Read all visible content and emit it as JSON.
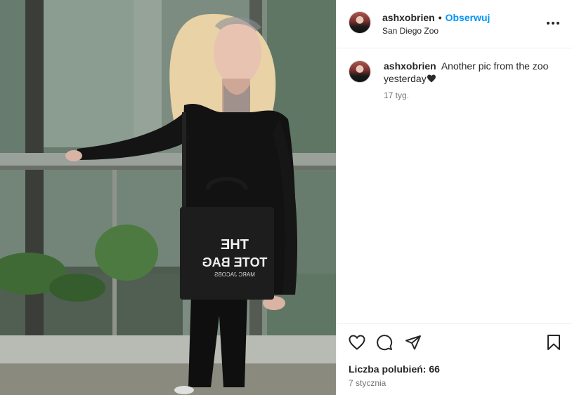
{
  "post": {
    "photo_icon": "photo-of-woman-with-tote-bag",
    "bag_text_line1": "THE",
    "bag_text_line2": "TOTE BAG",
    "bag_text_line3": "MARC JACOBS"
  },
  "header": {
    "username": "ashxobrien",
    "separator": "•",
    "follow_label": "Obserwuj",
    "location": "San Diego Zoo",
    "more_icon": "more-horizontal-icon"
  },
  "caption": {
    "username": "ashxobrien",
    "text": "Another pic from the zoo yesterday",
    "emoji_icon": "black-heart-icon",
    "age": "17 tyg."
  },
  "actions": {
    "like_icon": "heart-icon",
    "comment_icon": "comment-icon",
    "share_icon": "paper-plane-icon",
    "save_icon": "bookmark-icon",
    "likes_label": "Liczba polubień: 66",
    "date": "7 stycznia"
  },
  "colors": {
    "follow": "#0095f6",
    "text": "#262626",
    "muted": "#737373",
    "divider": "#efefef"
  }
}
